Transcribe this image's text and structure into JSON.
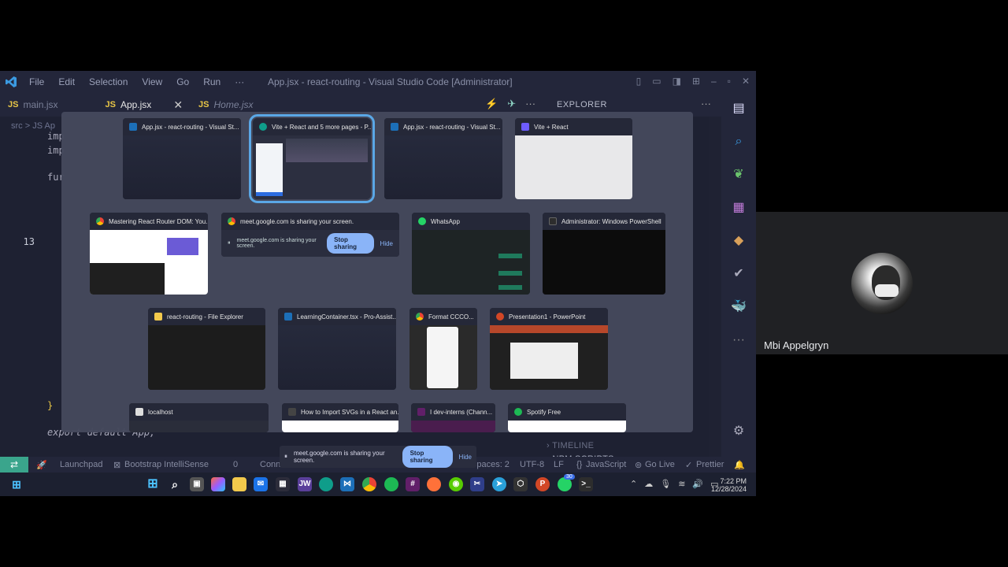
{
  "vscode": {
    "menu": [
      "File",
      "Edit",
      "Selection",
      "View",
      "Go",
      "Run",
      "···"
    ],
    "window_title": "App.jsx - react-routing - Visual Studio Code [Administrator]",
    "tabs": [
      {
        "badge": "JS",
        "label": "main.jsx"
      },
      {
        "badge": "JS",
        "label": "App.jsx"
      },
      {
        "badge": "JS",
        "label": "Home.jsx"
      }
    ],
    "explorer_title": "EXPLORER",
    "breadcrumb": "src > JS Ap",
    "code": {
      "line1": "imp",
      "line2": "imp",
      "line3": "fur",
      "line_number": "13",
      "close_brace": "}",
      "export_line": "export default App;"
    },
    "explorer_sections": [
      "TIMELINE",
      "NPM SCRIPTS"
    ],
    "status": {
      "launchpad": "Launchpad",
      "bootstrap": "Bootstrap IntelliSense",
      "count": "0",
      "conn": "Conn",
      "spaces": "Spaces: 2",
      "encoding": "UTF-8",
      "eol": "LF",
      "language": "JavaScript",
      "golive": "Go Live",
      "prettier": "Prettier"
    }
  },
  "switcher": {
    "windows": [
      {
        "title": "App.jsx - react-routing - Visual St...",
        "icon": "vscode-icon"
      },
      {
        "title": "Vite + React and 5 more pages - P...",
        "icon": "edge-icon",
        "selected": true
      },
      {
        "title": "App.jsx - react-routing - Visual St...",
        "icon": "vscode-icon"
      },
      {
        "title": "Vite + React",
        "icon": "vite-icon"
      },
      {
        "title": "Mastering React Router DOM: You...",
        "icon": "chrome-icon"
      },
      {
        "title": "meet.google.com is sharing your screen.",
        "icon": "chrome-icon"
      },
      {
        "title": "WhatsApp",
        "icon": "whatsapp-icon"
      },
      {
        "title": "Administrator: Windows PowerShell",
        "icon": "terminal-icon"
      },
      {
        "title": "react-routing - File Explorer",
        "icon": "folder-icon"
      },
      {
        "title": "LearningContainer.tsx - Pro-Assist...",
        "icon": "vscode-icon"
      },
      {
        "title": "Format CCCO...",
        "icon": "doc-icon"
      },
      {
        "title": "Presentation1 - PowerPoint",
        "icon": "powerpoint-icon"
      },
      {
        "title": "localhost",
        "icon": "page-icon"
      },
      {
        "title": "How to Import SVGs in a React an...",
        "icon": "ai-icon"
      },
      {
        "title": "I dev-interns (Chann...",
        "icon": "slack-icon"
      },
      {
        "title": "Spotify Free",
        "icon": "spotify-icon"
      }
    ],
    "share_card": {
      "text": "meet.google.com is sharing your screen.",
      "stop": "Stop sharing",
      "hide": "Hide"
    }
  },
  "share_bar": {
    "text": "meet.google.com is sharing your screen.",
    "stop": "Stop sharing",
    "hide": "Hide"
  },
  "taskbar": {
    "time": "7:22 PM",
    "date": "12/28/2024",
    "badges": {
      "whatsapp": "30"
    }
  },
  "meet": {
    "participant_name": "Mbi Appelgryn"
  },
  "colors": {
    "accent_blue": "#5aa7e6",
    "stop_button": "#8ab4f8",
    "remote_green": "#3aa58c"
  }
}
